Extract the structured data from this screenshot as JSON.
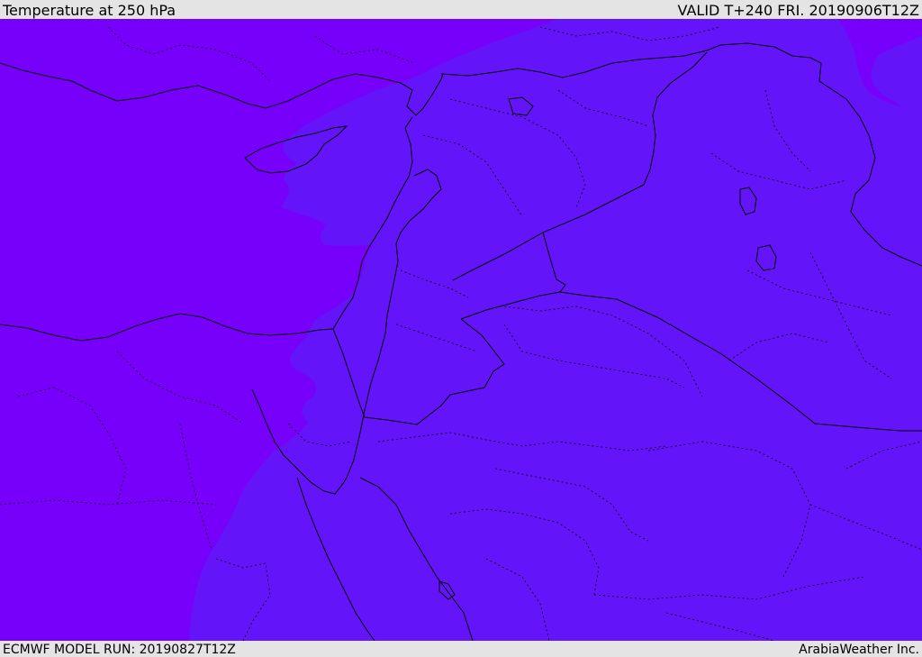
{
  "header": {
    "title": "Temperature at 250 hPa",
    "valid": "VALID T+240 FRI. 20190906T12Z"
  },
  "footer": {
    "model_run": "ECMWF MODEL RUN: 20190827T12Z",
    "credit": "ArabiaWeather Inc."
  },
  "map": {
    "colors": {
      "warm_region": "#7700fa",
      "cool_region": "#6414f8",
      "borders": "#000000"
    }
  }
}
